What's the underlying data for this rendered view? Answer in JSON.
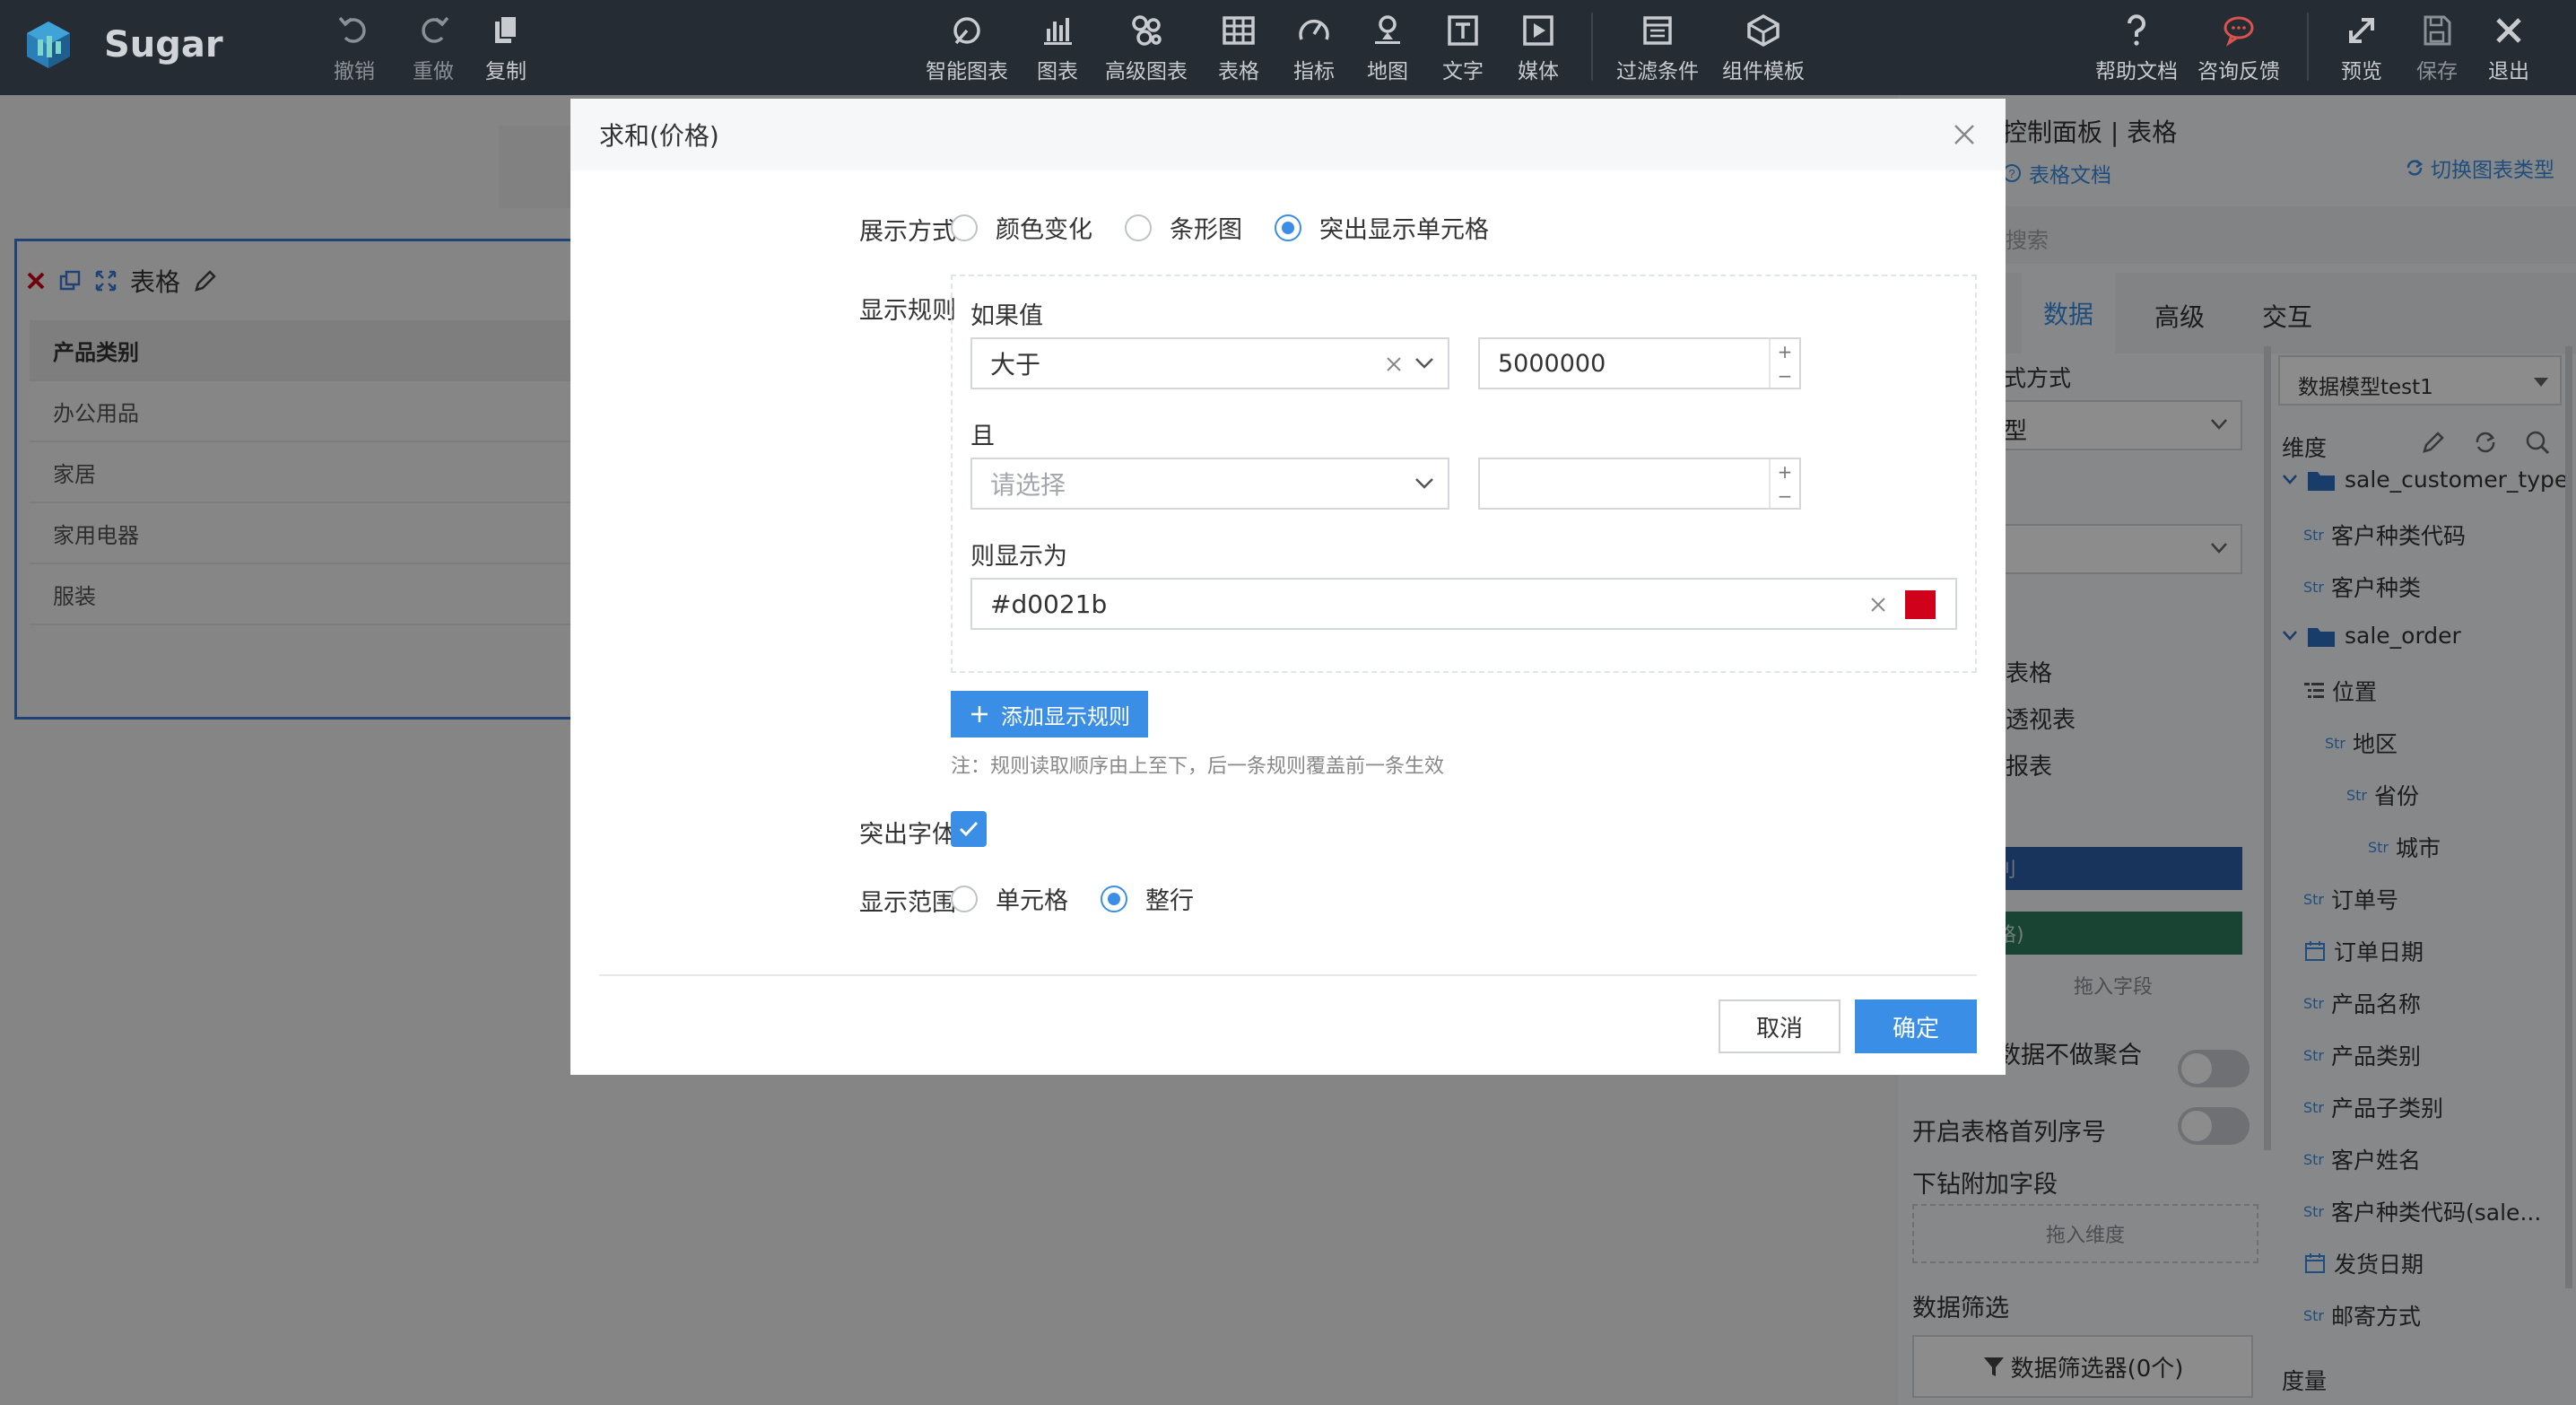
{
  "app": {
    "name": "Sugar"
  },
  "toolbar": {
    "left": [
      {
        "label": "撤销",
        "icon": "undo-icon"
      },
      {
        "label": "重做",
        "icon": "redo-icon"
      },
      {
        "label": "复制",
        "icon": "copy-icon"
      }
    ],
    "center": [
      {
        "label": "智能图表",
        "icon": "smart-chart-icon"
      },
      {
        "label": "图表",
        "icon": "bar-chart-icon"
      },
      {
        "label": "高级图表",
        "icon": "advanced-chart-icon"
      },
      {
        "label": "表格",
        "icon": "table-icon"
      },
      {
        "label": "指标",
        "icon": "gauge-icon"
      },
      {
        "label": "地图",
        "icon": "map-pin-icon"
      },
      {
        "label": "文字",
        "icon": "text-icon"
      },
      {
        "label": "媒体",
        "icon": "media-icon"
      },
      {
        "label": "过滤条件",
        "icon": "filter-icon"
      },
      {
        "label": "组件模板",
        "icon": "template-icon"
      }
    ],
    "right": [
      {
        "label": "帮助文档",
        "icon": "help-icon"
      },
      {
        "label": "咨询反馈",
        "icon": "feedback-icon"
      },
      {
        "label": "预览",
        "icon": "expand-icon"
      },
      {
        "label": "保存",
        "icon": "save-icon"
      },
      {
        "label": "退出",
        "icon": "close-icon"
      }
    ]
  },
  "widget": {
    "title": "表格",
    "header": "产品类别",
    "rows": [
      "办公用品",
      "家居",
      "家用电器",
      "服装"
    ]
  },
  "panel": {
    "title": "控制面板 | 表格",
    "doc_link": "表格文档",
    "switch_type": "切换图表类型",
    "search_placeholder": "搜索",
    "tabs": [
      "数据",
      "高级",
      "交互"
    ],
    "left_fragments": [
      "式方式",
      "型",
      "表格",
      "透视表",
      "报表",
      "刂",
      "格)"
    ],
    "drop_field": "拖入字段",
    "toggles": [
      "数据不做聚合",
      "开启表格首列序号"
    ],
    "drill_label": "下钻附加字段",
    "drop_dimension": "拖入维度",
    "filter_label": "数据筛选",
    "filter_button": "数据筛选器(0个)",
    "model": "数据模型test1",
    "dimension_label": "维度",
    "measure_label": "度量",
    "tree": [
      {
        "label": "sale_customer_type",
        "kind": "folder",
        "indent": 0
      },
      {
        "label": "客户种类代码",
        "kind": "str",
        "indent": 1
      },
      {
        "label": "客户种类",
        "kind": "str",
        "indent": 1
      },
      {
        "label": "sale_order",
        "kind": "folder",
        "indent": 0
      },
      {
        "label": "位置",
        "kind": "hier",
        "indent": 1
      },
      {
        "label": "地区",
        "kind": "str",
        "indent": 2
      },
      {
        "label": "省份",
        "kind": "str",
        "indent": 3
      },
      {
        "label": "城市",
        "kind": "str",
        "indent": 4
      },
      {
        "label": "订单号",
        "kind": "str",
        "indent": 1
      },
      {
        "label": "订单日期",
        "kind": "date",
        "indent": 1
      },
      {
        "label": "产品名称",
        "kind": "str",
        "indent": 1
      },
      {
        "label": "产品类别",
        "kind": "str",
        "indent": 1
      },
      {
        "label": "产品子类别",
        "kind": "str",
        "indent": 1
      },
      {
        "label": "客户姓名",
        "kind": "str",
        "indent": 1
      },
      {
        "label": "客户种类代码(sale...",
        "kind": "str",
        "indent": 1
      },
      {
        "label": "发货日期",
        "kind": "date",
        "indent": 1
      },
      {
        "label": "邮寄方式",
        "kind": "str",
        "indent": 1
      }
    ],
    "str_tag": "Str"
  },
  "dialog": {
    "title": "求和(价格)",
    "display_mode_label": "展示方式",
    "display_modes": [
      "颜色变化",
      "条形图",
      "突出显示单元格"
    ],
    "display_mode_selected": 2,
    "rule_label": "显示规则",
    "if_value_label": "如果值",
    "condition1": "大于",
    "value1": "5000000",
    "and_label": "且",
    "condition2_placeholder": "请选择",
    "value2": "",
    "then_label": "则显示为",
    "color_value": "#d0021b",
    "add_rule": "添加显示规则",
    "note": "注：规则读取顺序由上至下，后一条规则覆盖前一条生效",
    "bold_label": "突出字体",
    "bold_checked": true,
    "scope_label": "显示范围",
    "scopes": [
      "单元格",
      "整行"
    ],
    "scope_selected": 1,
    "cancel": "取消",
    "confirm": "确定"
  },
  "colors": {
    "accent": "#3a8ee6",
    "topbar": "#262c33",
    "highlight": "#d0021b"
  }
}
